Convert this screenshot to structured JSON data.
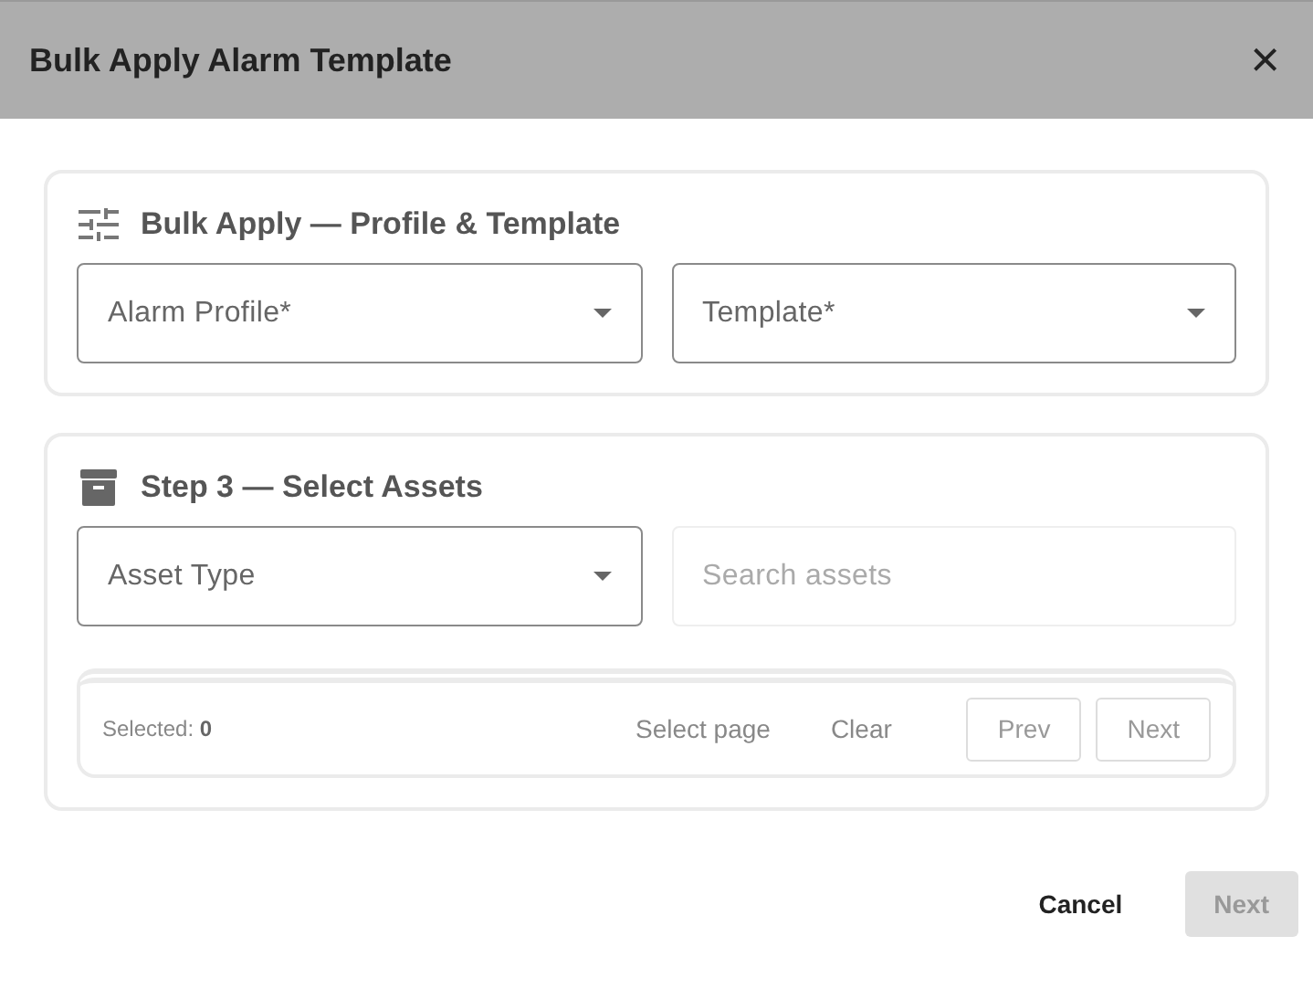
{
  "dialog": {
    "title": "Bulk Apply Alarm Template",
    "close": "×"
  },
  "sections": [
    {
      "kind": "profile",
      "title": "Bulk Apply — Profile & Template",
      "fields": [
        {
          "kind": "select",
          "label": "Alarm Profile*",
          "disabled": false
        },
        {
          "kind": "select",
          "label": "Template*",
          "disabled": false
        }
      ]
    },
    {
      "kind": "assets",
      "title": "Step 3 — Select Assets",
      "fields": [
        {
          "kind": "select",
          "label": "Asset Type",
          "disabled": false
        },
        {
          "kind": "search",
          "placeholder": "Search assets",
          "disabled": true
        }
      ],
      "pager": {
        "selected": "Selected: **0**",
        "actions": [
          "Select page",
          "Clear"
        ],
        "buttons": [
          {
            "label": "Prev",
            "disabled": true
          },
          {
            "label": "Next",
            "disabled": true
          }
        ]
      }
    }
  ],
  "footer": [
    {
      "label": "Cancel",
      "disabled": false
    },
    {
      "label": "Next",
      "disabled": true
    }
  ]
}
